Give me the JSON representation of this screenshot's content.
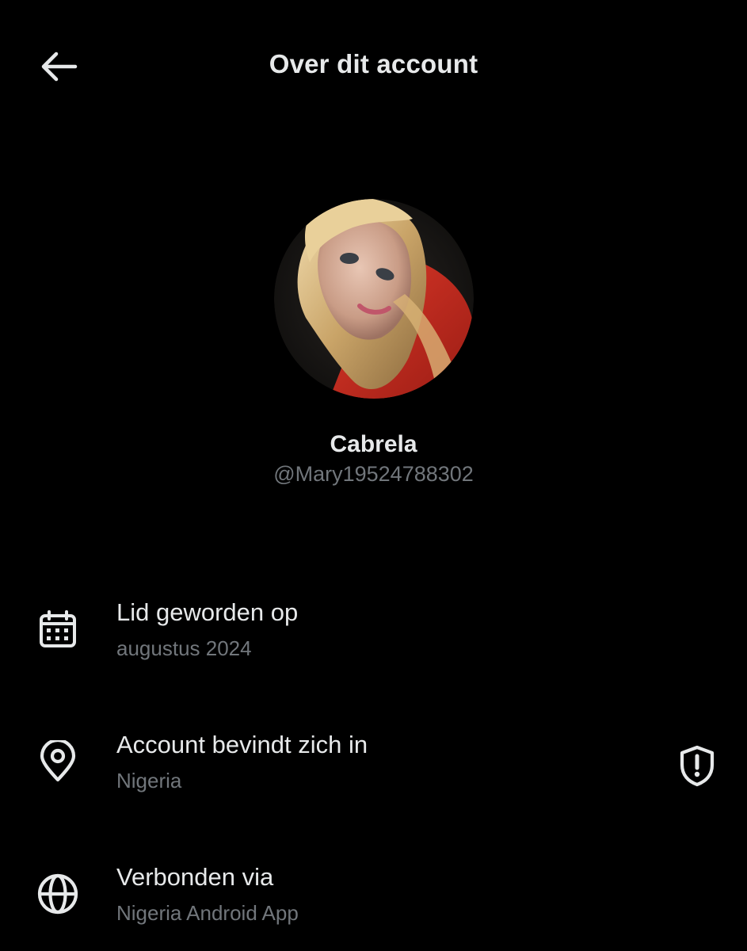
{
  "header": {
    "title": "Over dit account",
    "back_icon": "arrow-left-icon"
  },
  "profile": {
    "display_name": "Cabrela",
    "handle": "@Mary19524788302",
    "avatar_icon": "profile-photo"
  },
  "details": [
    {
      "icon": "calendar-icon",
      "label": "Lid geworden op",
      "value": "augustus 2024"
    },
    {
      "icon": "location-pin-icon",
      "label": "Account bevindt zich in",
      "value": "Nigeria",
      "action_icon": "shield-alert-icon"
    },
    {
      "icon": "globe-icon",
      "label": "Verbonden via",
      "value": "Nigeria Android App"
    }
  ],
  "colors": {
    "background": "#000000",
    "primary_text": "#e7e9ea",
    "secondary_text": "#71767b"
  }
}
